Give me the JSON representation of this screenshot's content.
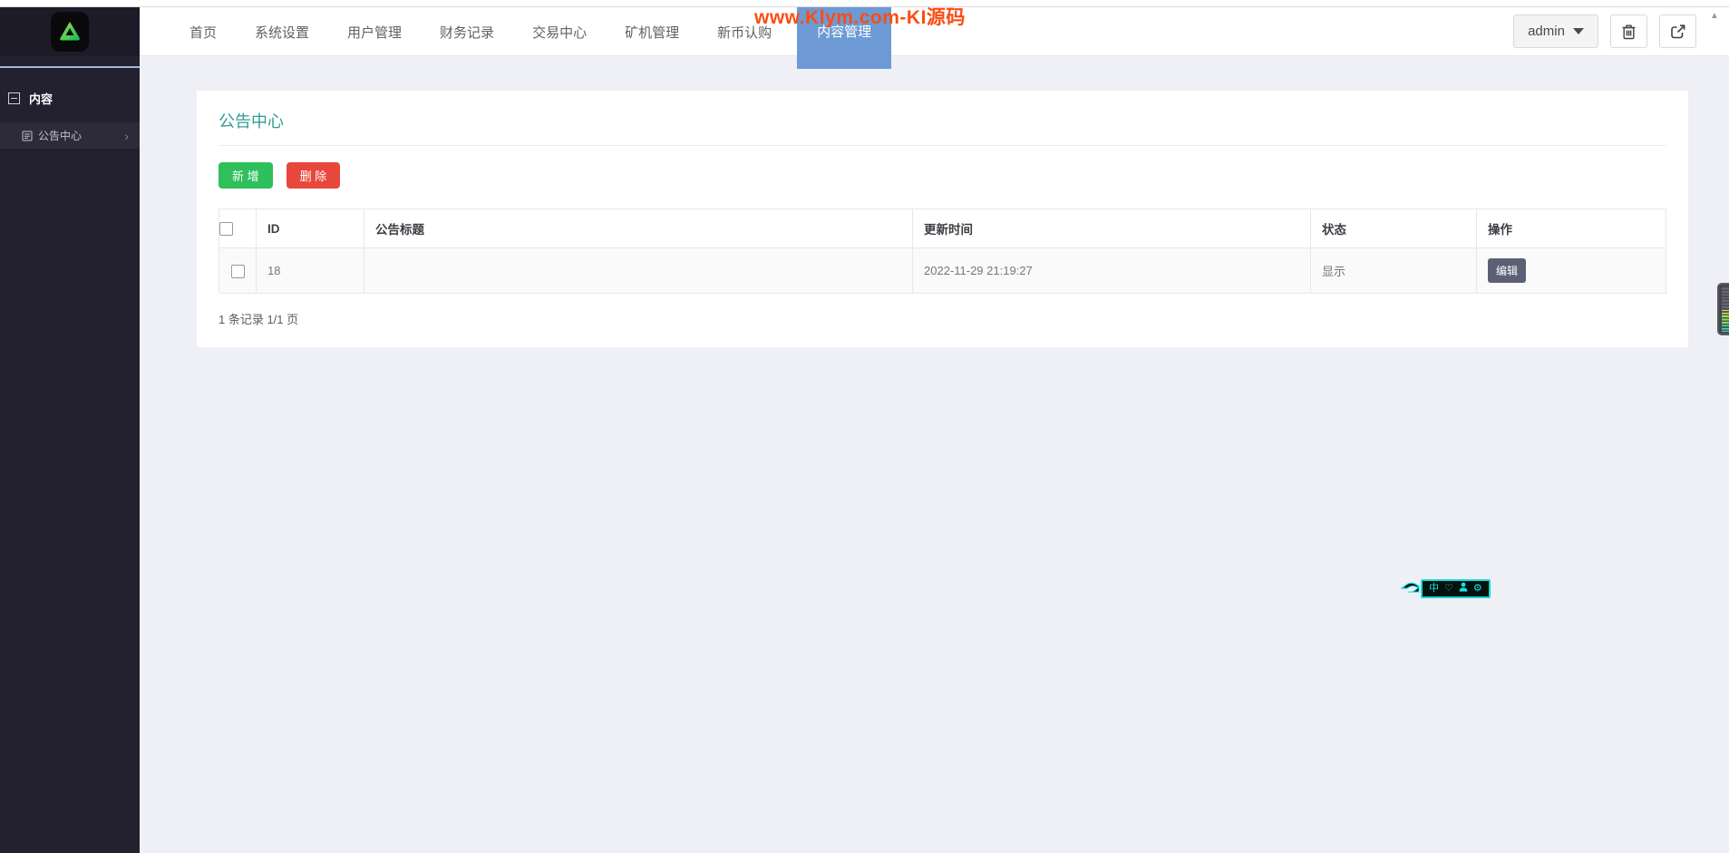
{
  "watermark_text": "www.Klym.com-KI源码",
  "header": {
    "nav_items": [
      "首页",
      "系统设置",
      "用户管理",
      "财务记录",
      "交易中心",
      "矿机管理",
      "新币认购"
    ],
    "active_tab": "内容管理",
    "user_menu_label": "admin"
  },
  "sidebar": {
    "section_label": "内容",
    "menu_item_label": "公告中心"
  },
  "content": {
    "title": "公告中心",
    "add_button": "新 增",
    "delete_button": "删 除",
    "table": {
      "columns": [
        "ID",
        "公告标题",
        "更新时间",
        "状态",
        "操作"
      ],
      "row": {
        "id": "18",
        "title": "",
        "updated_at": "2022-11-29 21:19:27",
        "status": "显示",
        "edit_button": "编辑"
      }
    },
    "pagination": "1 条记录 1/1 页"
  },
  "icons": {
    "chevron_right": "›",
    "scroll_up": "▲",
    "widget_zh_char": "中",
    "widget_heart": "♡",
    "widget_gear": "⚙"
  },
  "colors": {
    "active_tab_bg": "#6d9ad4",
    "watermark_orange": "#fb4c12",
    "title_teal": "#2f9d90",
    "add_green": "#2fbf5b",
    "delete_red": "#e8483c",
    "edit_slate": "#5b6074",
    "widget_cyan": "#17d8d8",
    "sidebar_dark": "#232130",
    "sidebar_accent": "#a9b3e8"
  }
}
